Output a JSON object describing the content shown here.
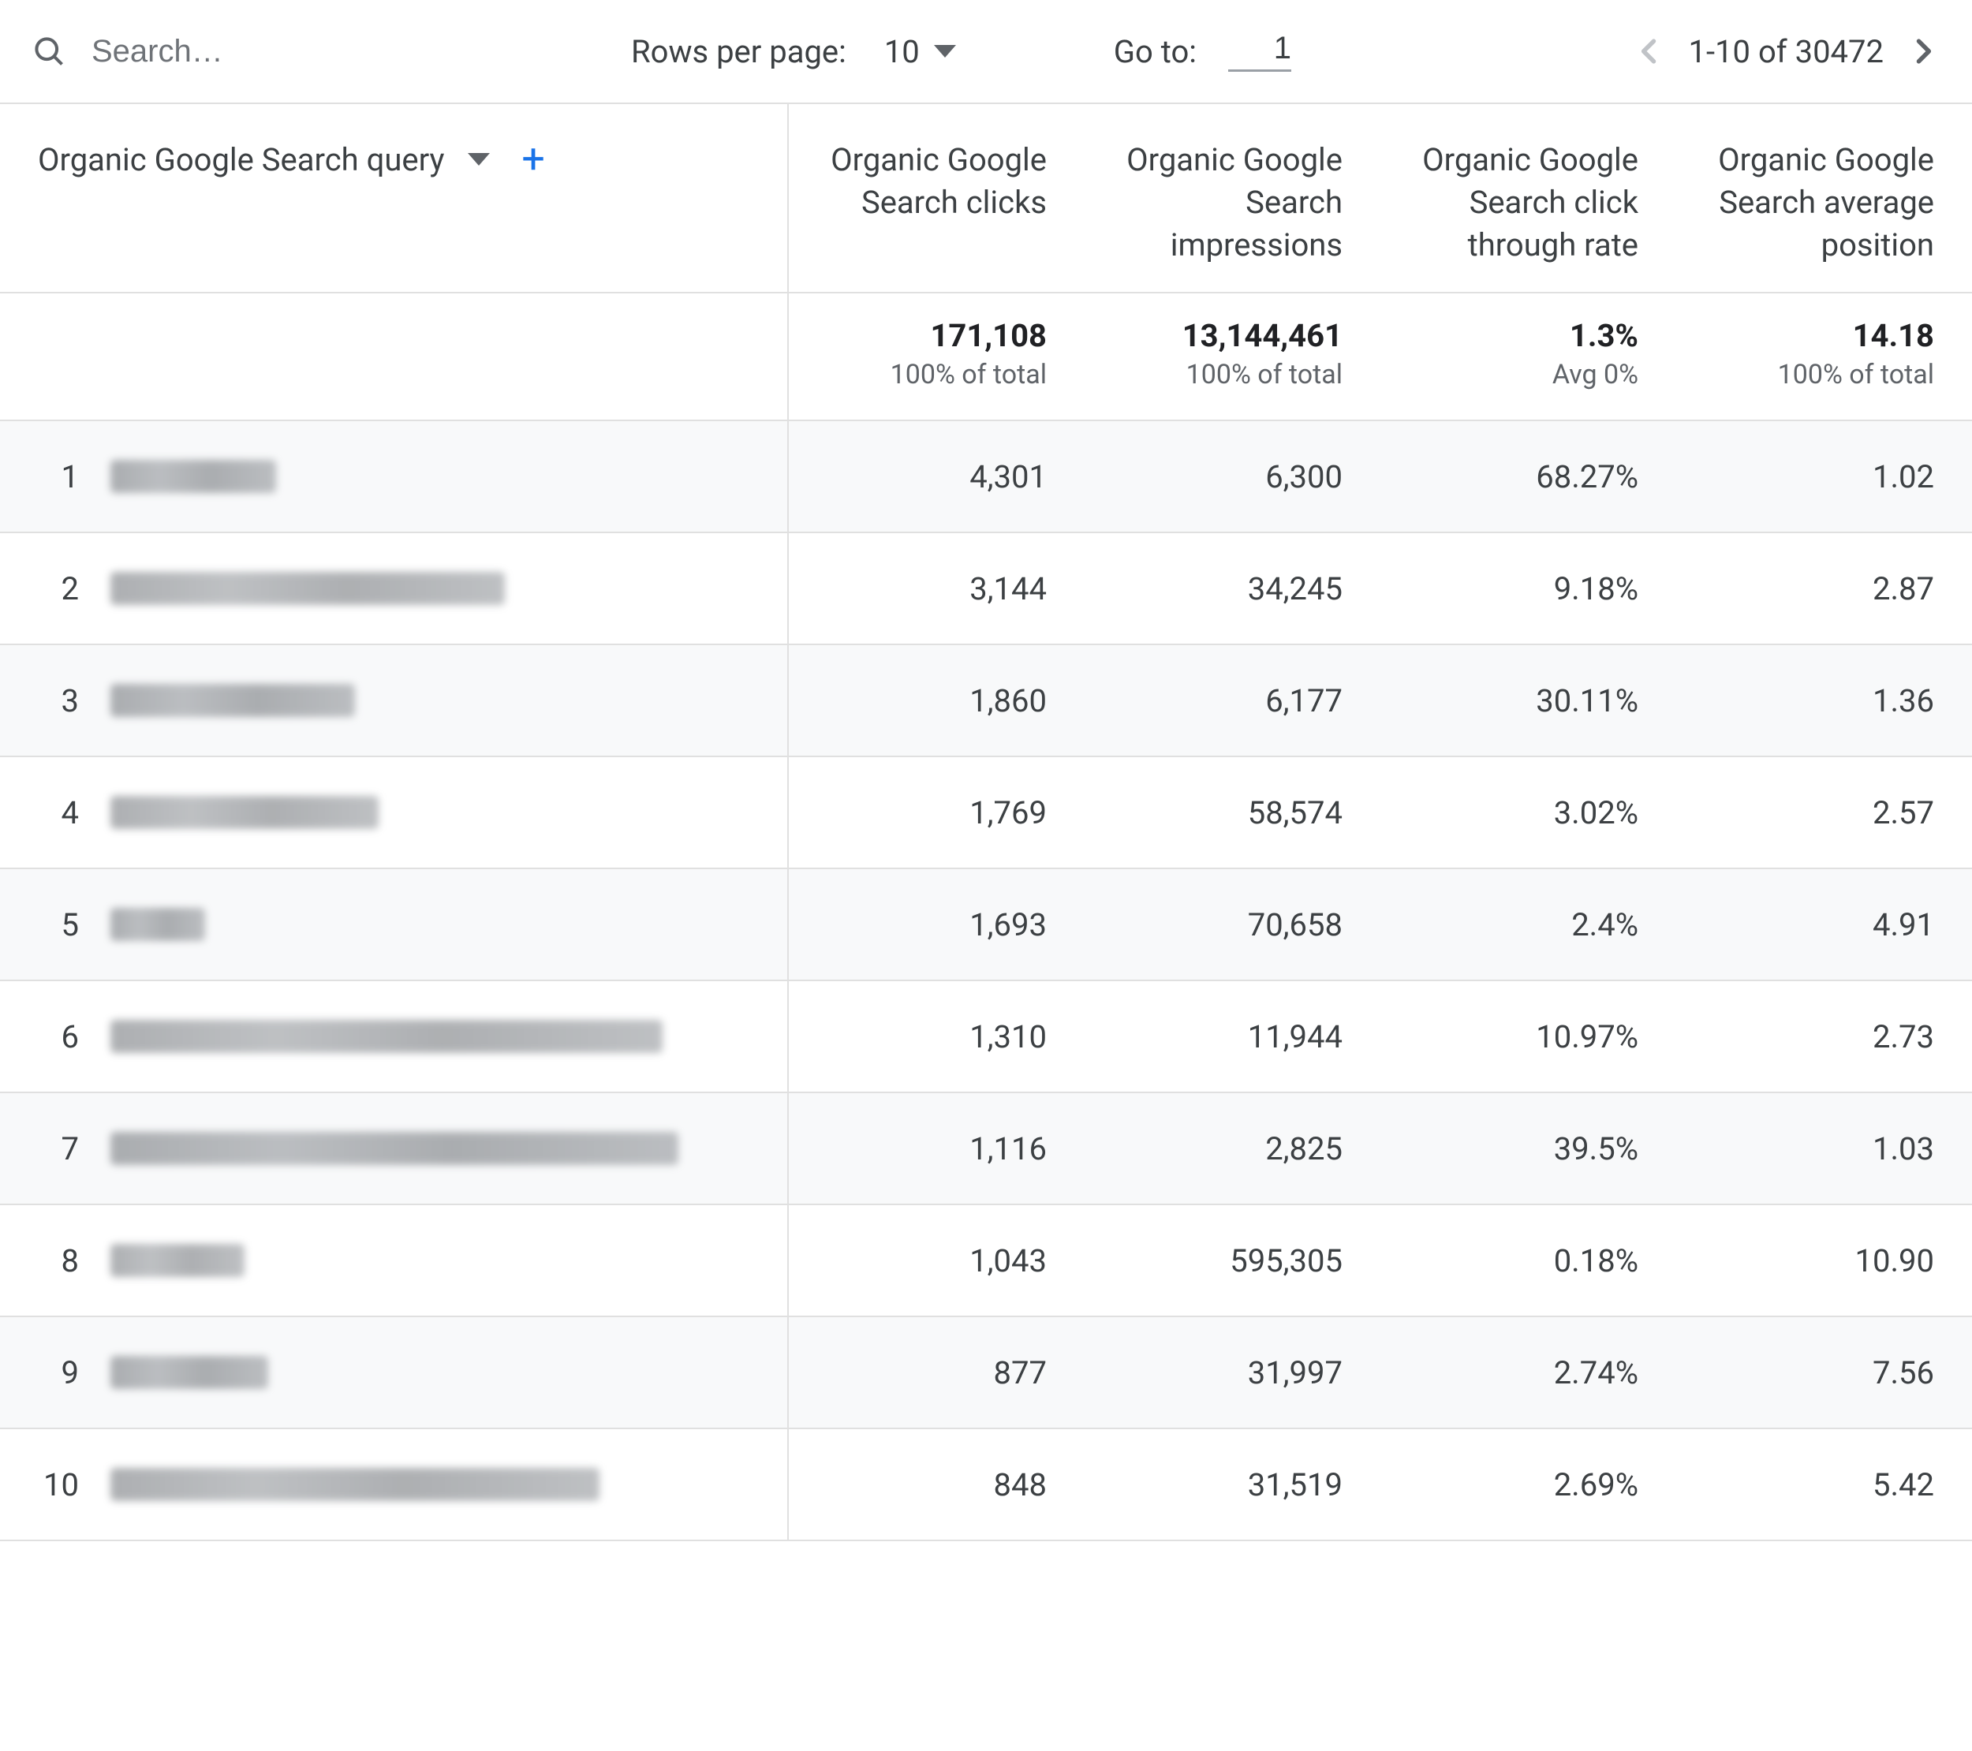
{
  "toolbar": {
    "search_placeholder": "Search…",
    "rows_per_page_label": "Rows per page:",
    "rows_per_page_value": "10",
    "goto_label": "Go to:",
    "goto_value": "1",
    "page_range": "1-10 of 30472"
  },
  "table": {
    "dimension_label": "Organic Google Search query",
    "columns": [
      "Organic Google Search clicks",
      "Organic Google Search impressions",
      "Organic Google Search click through rate",
      "Organic Google Search average position"
    ],
    "summary": {
      "values": [
        "171,108",
        "13,144,461",
        "1.3%",
        "14.18"
      ],
      "subs": [
        "100% of total",
        "100% of total",
        "Avg 0%",
        "100% of total"
      ]
    },
    "rows": [
      {
        "index": "1",
        "blur_width": 210,
        "clicks": "4,301",
        "impressions": "6,300",
        "ctr": "68.27%",
        "position": "1.02"
      },
      {
        "index": "2",
        "blur_width": 500,
        "clicks": "3,144",
        "impressions": "34,245",
        "ctr": "9.18%",
        "position": "2.87"
      },
      {
        "index": "3",
        "blur_width": 310,
        "clicks": "1,860",
        "impressions": "6,177",
        "ctr": "30.11%",
        "position": "1.36"
      },
      {
        "index": "4",
        "blur_width": 340,
        "clicks": "1,769",
        "impressions": "58,574",
        "ctr": "3.02%",
        "position": "2.57"
      },
      {
        "index": "5",
        "blur_width": 120,
        "clicks": "1,693",
        "impressions": "70,658",
        "ctr": "2.4%",
        "position": "4.91"
      },
      {
        "index": "6",
        "blur_width": 700,
        "clicks": "1,310",
        "impressions": "11,944",
        "ctr": "10.97%",
        "position": "2.73"
      },
      {
        "index": "7",
        "blur_width": 720,
        "clicks": "1,116",
        "impressions": "2,825",
        "ctr": "39.5%",
        "position": "1.03"
      },
      {
        "index": "8",
        "blur_width": 170,
        "clicks": "1,043",
        "impressions": "595,305",
        "ctr": "0.18%",
        "position": "10.90"
      },
      {
        "index": "9",
        "blur_width": 200,
        "clicks": "877",
        "impressions": "31,997",
        "ctr": "2.74%",
        "position": "7.56"
      },
      {
        "index": "10",
        "blur_width": 620,
        "clicks": "848",
        "impressions": "31,519",
        "ctr": "2.69%",
        "position": "5.42"
      }
    ]
  }
}
